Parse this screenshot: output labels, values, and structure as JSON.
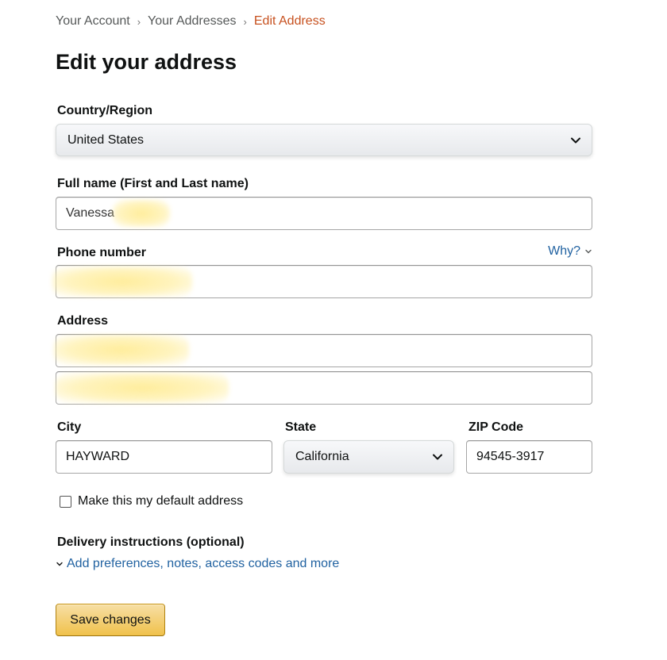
{
  "breadcrumb": {
    "items": [
      "Your Account",
      "Your Addresses"
    ],
    "current": "Edit Address"
  },
  "page_title": "Edit your address",
  "country": {
    "label": "Country/Region",
    "value": "United States"
  },
  "full_name": {
    "label": "Full name (First and Last name)",
    "value": "Vanessa"
  },
  "phone": {
    "label": "Phone number",
    "why_link": "Why?"
  },
  "address": {
    "label": "Address"
  },
  "city": {
    "label": "City",
    "value": "HAYWARD"
  },
  "state": {
    "label": "State",
    "value": "California"
  },
  "zip": {
    "label": "ZIP Code",
    "value": "94545-3917"
  },
  "default_checkbox": {
    "label": "Make this my default address",
    "checked": false
  },
  "delivery": {
    "label": "Delivery instructions (optional)",
    "link": "Add preferences, notes, access codes and more"
  },
  "save_button": "Save changes",
  "colors": {
    "link": "#2162a1",
    "breadcrumb_current": "#c7511f",
    "button": "#f0c14b"
  },
  "icons": {
    "select_chevron": "chevron-down-icon",
    "why_chevron": "chevron-down-icon",
    "link_chevron": "chevron-down-icon"
  }
}
